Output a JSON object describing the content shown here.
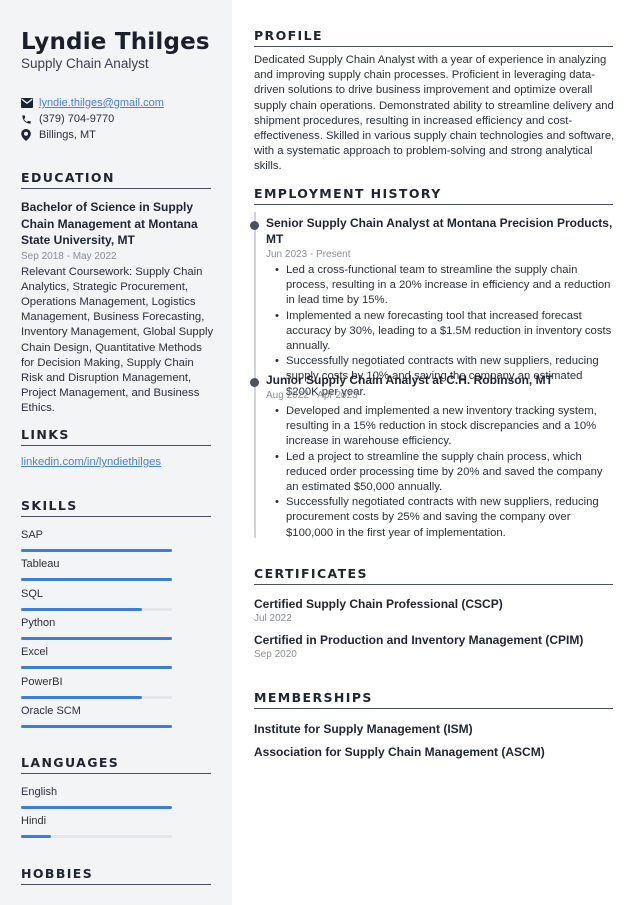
{
  "header": {
    "name": "Lyndie Thilges",
    "job_title": "Supply Chain Analyst"
  },
  "contact": {
    "email": "lyndie.thilges@gmail.com",
    "phone": "(379) 704-9770",
    "location": "Billings, MT",
    "icons": [
      "envelope-icon",
      "phone-icon",
      "location-pin-icon"
    ]
  },
  "education": {
    "heading": "EDUCATION",
    "degree": "Bachelor of Science in Supply Chain Management at Montana State University, MT",
    "dates": "Sep 2018 - May 2022",
    "description": "Relevant Coursework: Supply Chain Analytics, Strategic Procurement, Operations Management, Logistics Management, Business Forecasting, Inventory Management, Global Supply Chain Design, Quantitative Methods for Decision Making, Supply Chain Risk and Disruption Management, Project Management, and Business Ethics."
  },
  "links": {
    "heading": "LINKS",
    "items": [
      "linkedin.com/in/lyndiethilges"
    ]
  },
  "skills": {
    "heading": "SKILLS",
    "items": [
      {
        "name": "SAP",
        "level": 1.0
      },
      {
        "name": "Tableau",
        "level": 1.0
      },
      {
        "name": "SQL",
        "level": 0.8
      },
      {
        "name": "Python",
        "level": 1.0
      },
      {
        "name": "Excel",
        "level": 1.0
      },
      {
        "name": "PowerBI",
        "level": 0.8
      },
      {
        "name": "Oracle SCM",
        "level": 1.0
      }
    ]
  },
  "languages": {
    "heading": "LANGUAGES",
    "items": [
      {
        "name": "English",
        "level": 1.0
      },
      {
        "name": "Hindi",
        "level": 0.2
      }
    ]
  },
  "hobbies": {
    "heading": "HOBBIES"
  },
  "profile": {
    "heading": "PROFILE",
    "text": "Dedicated Supply Chain Analyst with a year of experience in analyzing and improving supply chain processes. Proficient in leveraging data-driven solutions to drive business improvement and optimize overall supply chain operations. Demonstrated ability to streamline delivery and shipment procedures, resulting in increased efficiency and cost-effectiveness. Skilled in various supply chain technologies and software, with a systematic approach to problem-solving and strong analytical skills."
  },
  "employment": {
    "heading": "EMPLOYMENT HISTORY",
    "jobs": [
      {
        "title": "Senior Supply Chain Analyst at Montana Precision Products, MT",
        "dates": "Jun 2023 - Present",
        "bullets": [
          "Led a cross-functional team to streamline the supply chain process, resulting in a 20% increase in efficiency and a reduction in lead time by 15%.",
          "Implemented a new forecasting tool that increased forecast accuracy by 30%, leading to a $1.5M reduction in inventory costs annually.",
          "Successfully negotiated contracts with new suppliers, reducing supply costs by 10% and saving the company an estimated $200K per year."
        ]
      },
      {
        "title": "Junior Supply Chain Analyst at C.H. Robinson, MT",
        "dates": "Aug 2022 - Apr 2023",
        "bullets": [
          "Developed and implemented a new inventory tracking system, resulting in a 15% reduction in stock discrepancies and a 10% increase in warehouse efficiency.",
          "Led a project to streamline the supply chain process, which reduced order processing time by 20% and saved the company an estimated $50,000 annually.",
          "Successfully negotiated contracts with new suppliers, reducing procurement costs by 25% and saving the company over $100,000 in the first year of implementation."
        ]
      }
    ]
  },
  "certificates": {
    "heading": "CERTIFICATES",
    "items": [
      {
        "title": "Certified Supply Chain Professional (CSCP)",
        "date": "Jul 2022"
      },
      {
        "title": "Certified in Production and Inventory Management (CPIM)",
        "date": "Sep 2020"
      }
    ]
  },
  "memberships": {
    "heading": "MEMBERSHIPS",
    "items": [
      "Institute for Supply Management (ISM)",
      "Association for Supply Chain Management (ASCM)"
    ]
  },
  "colors": {
    "accent": "#3b7be6",
    "link": "#4a7ee0",
    "sidebar_bg": "#f3f4f6",
    "heading_rule": "#4b5160",
    "muted_text": "#8a8f98"
  }
}
